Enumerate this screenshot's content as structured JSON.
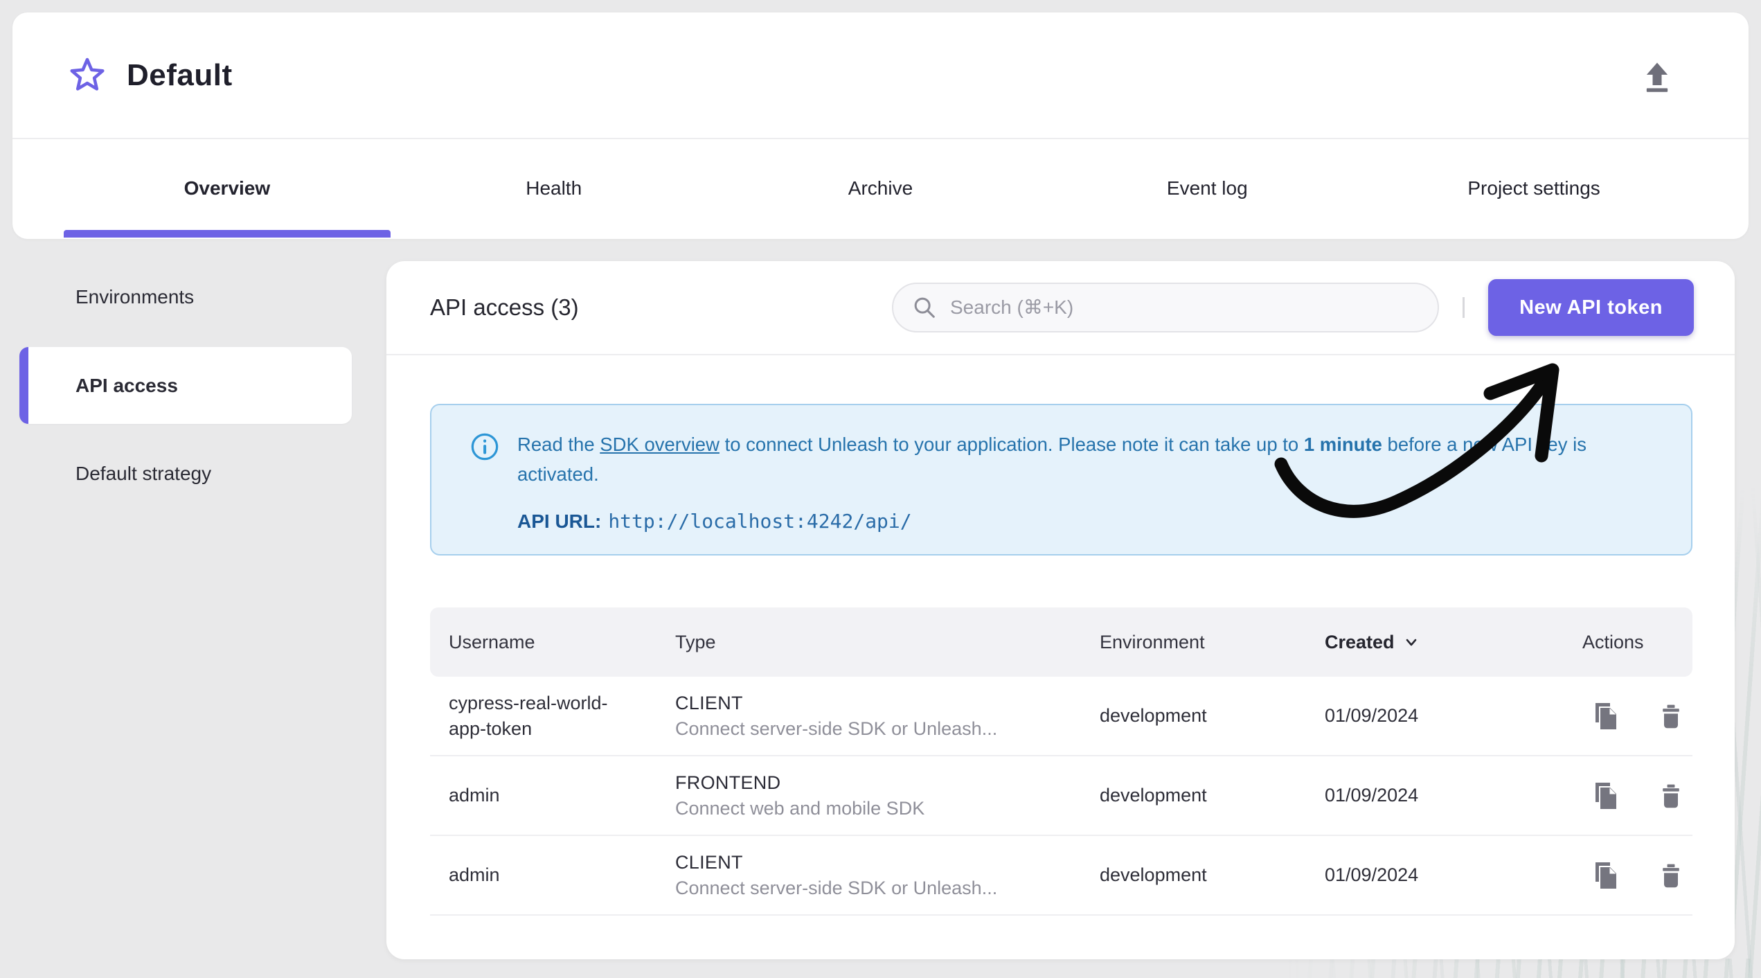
{
  "colors": {
    "primary": "#6D62E5",
    "banner_bg": "#E5F2FB",
    "banner_border": "#A6CFED",
    "banner_text": "#2673AC",
    "page_bg": "#E9E9EA"
  },
  "project_header": {
    "title": "Default",
    "favorite_icon": "star-outline-icon",
    "export_icon": "upload-icon"
  },
  "tabs": [
    {
      "label": "Overview",
      "active": true
    },
    {
      "label": "Health",
      "active": false
    },
    {
      "label": "Archive",
      "active": false
    },
    {
      "label": "Event log",
      "active": false
    },
    {
      "label": "Project settings",
      "active": false
    }
  ],
  "sidebar": {
    "items": [
      {
        "label": "Environments",
        "active": false
      },
      {
        "label": "API access",
        "active": true
      },
      {
        "label": "Default strategy",
        "active": false
      }
    ]
  },
  "panel": {
    "title": "API access (3)",
    "search": {
      "placeholder": "Search (⌘+K)",
      "icon": "magnifier-icon"
    },
    "new_token_button": "New API token",
    "banner": {
      "icon": "info-icon",
      "text_prefix": "Read the ",
      "link_text": "SDK overview",
      "text_middle": " to connect Unleash to your application. Please note it can take up to ",
      "text_bold": "1 minute",
      "text_suffix": " before a new API key is activated.",
      "api_url_label": "API URL:",
      "api_url_value": "http://localhost:4242/api/"
    },
    "table": {
      "headers": {
        "username": "Username",
        "type": "Type",
        "environment": "Environment",
        "created": "Created",
        "actions": "Actions"
      },
      "sort": {
        "column": "Created",
        "direction": "desc",
        "icon": "chevron-down-icon"
      },
      "row_icons": [
        "copy-icon",
        "trash-icon"
      ],
      "rows": [
        {
          "username": "cypress-real-world-app-token",
          "type": "CLIENT",
          "type_description": "Connect server-side SDK or Unleash...",
          "environment": "development",
          "created": "01/09/2024"
        },
        {
          "username": "admin",
          "type": "FRONTEND",
          "type_description": "Connect web and mobile SDK",
          "environment": "development",
          "created": "01/09/2024"
        },
        {
          "username": "admin",
          "type": "CLIENT",
          "type_description": "Connect server-side SDK or Unleash...",
          "environment": "development",
          "created": "01/09/2024"
        }
      ]
    }
  }
}
